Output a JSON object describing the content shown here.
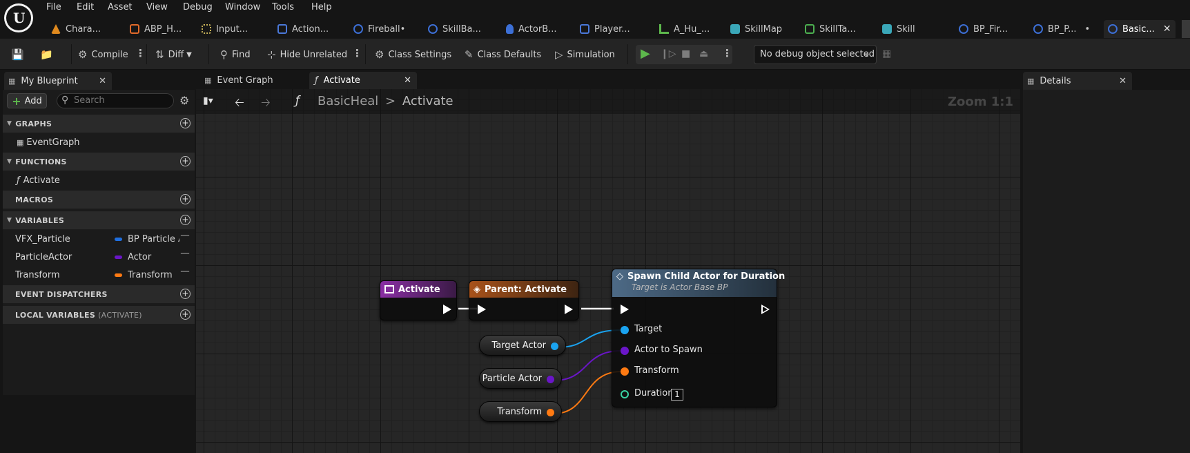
{
  "menu": [
    "File",
    "Edit",
    "Asset",
    "View",
    "Debug",
    "Window",
    "Tools",
    "Help"
  ],
  "doc_tabs": [
    {
      "label": "Chara...",
      "icon": "animation-icon",
      "color": "#e08a1e"
    },
    {
      "label": "ABP_H...",
      "icon": "anim-blueprint-icon",
      "color": "#e06a2a"
    },
    {
      "label": "Input...",
      "icon": "input-icon",
      "color": "#c9b45a"
    },
    {
      "label": "Action...",
      "icon": "function-icon",
      "color": "#4a78d8"
    },
    {
      "label": "Fireball•",
      "icon": "blueprint-icon",
      "color": "#3c6fd6"
    },
    {
      "label": "SkillBa...",
      "icon": "blueprint-icon",
      "color": "#3c6fd6"
    },
    {
      "label": "ActorB...",
      "icon": "actor-icon",
      "color": "#3c6fd6"
    },
    {
      "label": "Player...",
      "icon": "function-icon",
      "color": "#4a78d8"
    },
    {
      "label": "A_Hu_...",
      "icon": "anim-sequence-icon",
      "color": "#5db84c"
    },
    {
      "label": "SkillMap",
      "icon": "map-icon",
      "color": "#3aa7b8"
    },
    {
      "label": "SkillTa...",
      "icon": "datatable-icon",
      "color": "#4caf50"
    },
    {
      "label": "Skill",
      "icon": "struct-icon",
      "color": "#3aa7b8"
    },
    {
      "label": "BP_Fir...",
      "icon": "blueprint-icon",
      "color": "#3c6fd6"
    },
    {
      "label": "BP_P...",
      "icon": "blueprint-icon",
      "color": "#3c6fd6",
      "dirty": "•"
    },
    {
      "label": "Basic...",
      "icon": "blueprint-icon",
      "color": "#3c6fd6",
      "close": "✕"
    }
  ],
  "toolbar": {
    "compile": "Compile",
    "diff": "Diff",
    "find": "Find",
    "hide_unrelated": "Hide Unrelated",
    "class_settings": "Class Settings",
    "class_defaults": "Class Defaults",
    "simulation": "Simulation",
    "debug_select": "No debug object selected"
  },
  "left_panel": {
    "tab": "My Blueprint",
    "add": "Add",
    "search_placeholder": "Search",
    "sections": {
      "graphs": "GRAPHS",
      "functions": "FUNCTIONS",
      "macros": "MACROS",
      "variables": "VARIABLES",
      "dispatchers": "EVENT DISPATCHERS",
      "local_vars": "LOCAL VARIABLES",
      "local_vars_sub": "(ACTIVATE)"
    },
    "graphs": [
      "EventGraph"
    ],
    "functions": [
      "Activate"
    ],
    "variables": [
      {
        "name": "VFX_Particle",
        "type": "BP Particle A",
        "color": "#1f6fe0"
      },
      {
        "name": "ParticleActor",
        "type": "Actor",
        "color": "#6a16c8"
      },
      {
        "name": "Transform",
        "type": "Transform",
        "color": "#ff7a12"
      }
    ]
  },
  "graph_tabs": [
    "Event Graph",
    "Activate"
  ],
  "breadcrumb": {
    "root": "BasicHeal",
    "sep": ">",
    "current": "Activate"
  },
  "zoom": "Zoom 1:1",
  "nodes": {
    "activate": {
      "title": "Activate",
      "color": "#8a2fa4"
    },
    "parent": {
      "title": "Parent: Activate",
      "color": "#a8521a"
    },
    "spawn": {
      "title": "Spawn Child Actor for Duration",
      "subtitle": "Target is Actor Base BP",
      "color": "#4d6a86",
      "pins": {
        "target": "Target",
        "actor": "Actor to Spawn",
        "transform": "Transform",
        "duration": "Duration",
        "duration_value": "1"
      }
    },
    "target_actor": {
      "label": "Target Actor",
      "color": "#1aa3f0"
    },
    "particle_actor": {
      "label": "Particle Actor",
      "color": "#6a16c8"
    },
    "transform": {
      "label": "Transform",
      "color": "#ff7a12"
    }
  },
  "right_panel": {
    "tab": "Details"
  },
  "close_glyph": "✕"
}
